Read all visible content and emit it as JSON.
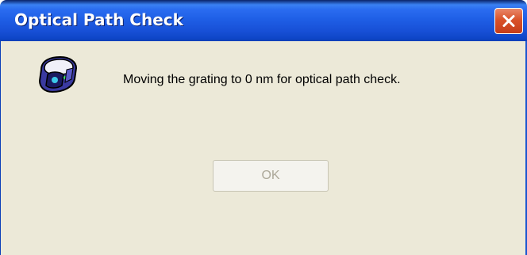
{
  "window": {
    "title": "Optical Path Check",
    "close_icon": "close-icon"
  },
  "dialog": {
    "icon": "spectrometer-device-icon",
    "message": "Moving the grating to 0 nm for optical path check.",
    "ok_label": "OK",
    "ok_enabled": false
  },
  "colors": {
    "titlebar": "#2a6cf0",
    "close_button": "#d9522a",
    "dialog_background": "#ece9d8",
    "disabled_text": "#aca899"
  }
}
